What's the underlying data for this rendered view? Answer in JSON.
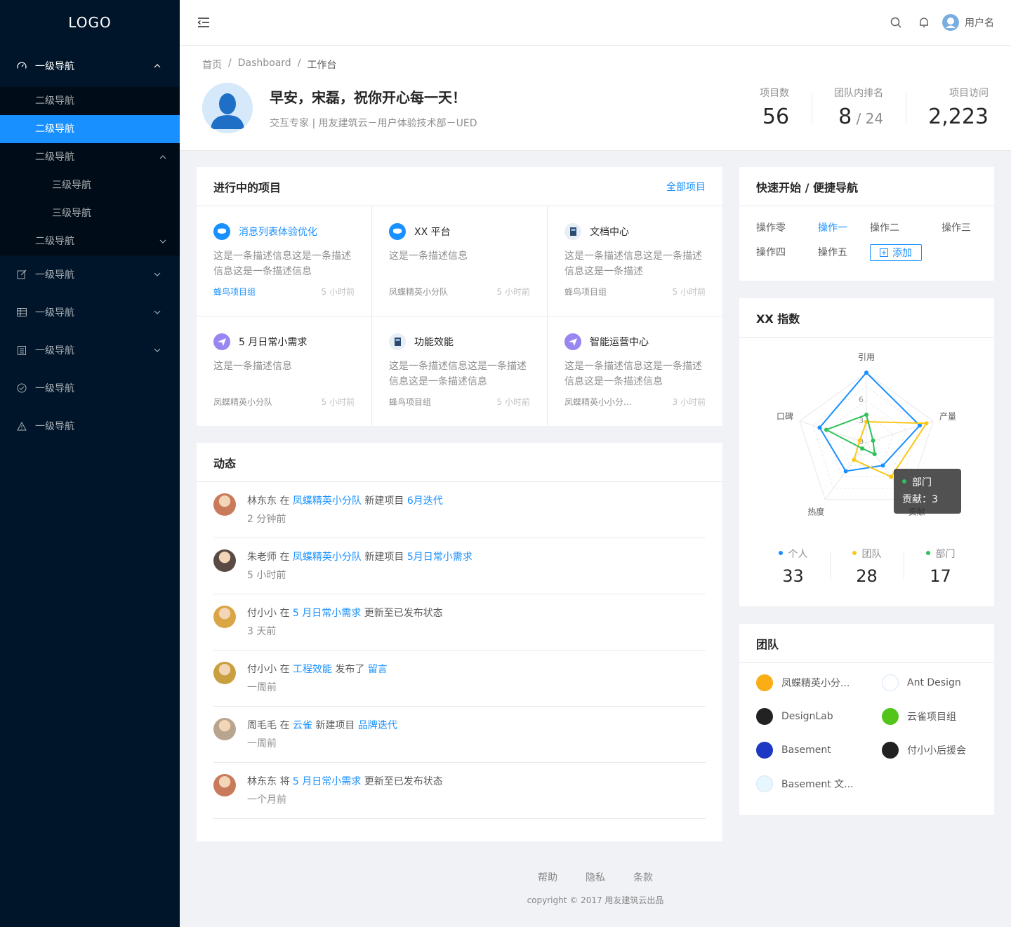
{
  "logo": "LOGO",
  "sidebar": {
    "group1": {
      "label": "一级导航",
      "items": [
        "二级导航",
        "二级导航"
      ],
      "expanded_item": "二级导航",
      "sub_items": [
        "三级导航",
        "三级导航"
      ],
      "last_item": "二级导航"
    },
    "others": [
      "一级导航",
      "一级导航",
      "一级导航",
      "一级导航",
      "一级导航"
    ]
  },
  "header": {
    "username": "用户名"
  },
  "breadcrumb": [
    "首页",
    "Dashboard",
    "工作台"
  ],
  "greeting": "早安，宋磊，祝你开心每一天！",
  "user_info": "交互专家 | 用友建筑云－用户体验技术部－UED",
  "stats": [
    {
      "title": "项目数",
      "value": "56"
    },
    {
      "title": "团队内排名",
      "value": "8",
      "total": "/ 24"
    },
    {
      "title": "项目访问",
      "value": "2,223"
    }
  ],
  "projects": {
    "title": "进行中的项目",
    "all_link": "全部项目",
    "items": [
      {
        "name": "消息列表体验优化",
        "desc": "这是一条描述信息这是一条描述信息这是一条描述信息",
        "group": "蜂鸟项目组",
        "time": "5 小时前",
        "icon": "message-bubble-icon"
      },
      {
        "name": "XX 平台",
        "desc": "这是一条描述信息",
        "group": "凤蝶精英小分队",
        "time": "5 小时前",
        "icon": "message-bubble-icon"
      },
      {
        "name": "文档中心",
        "desc": "这是一条描述信息这是一条描述信息这是一条描述",
        "group": "蜂鸟项目组",
        "time": "5 小时前",
        "icon": "book-icon"
      },
      {
        "name": "5 月日常小需求",
        "desc": "这是一条描述信息",
        "group": "凤蝶精英小分队",
        "time": "5 小时前",
        "icon": "paper-plane-icon"
      },
      {
        "name": "功能效能",
        "desc": "这是一条描述信息这是一条描述信息这是一条描述信息",
        "group": "蜂鸟项目组",
        "time": "5 小时前",
        "icon": "book-icon"
      },
      {
        "name": "智能运营中心",
        "desc": "这是一条描述信息这是一条描述信息这是一条描述信息",
        "group": "凤蝶精英小小分...",
        "time": "3 小时前",
        "icon": "paper-plane-icon"
      }
    ]
  },
  "activity": {
    "title": "动态",
    "items": [
      {
        "user": "林东东",
        "verb": "在",
        "target": "凤蝶精英小分队",
        "action": "新建项目",
        "obj": "6月迭代",
        "tail": "",
        "time": "2 分钟前"
      },
      {
        "user": "朱老师",
        "verb": "在",
        "target": "凤蝶精英小分队",
        "action": "新建项目",
        "obj": "5月日常小需求",
        "tail": "",
        "time": "5 小时前"
      },
      {
        "user": "付小小",
        "verb": "在",
        "target": "5 月日常小需求",
        "action": "更新至已发布状态",
        "obj": "",
        "tail": "",
        "time": "3 天前"
      },
      {
        "user": "付小小",
        "verb": "在",
        "target": "工程效能",
        "action": "发布了",
        "obj": "留言",
        "tail": "",
        "time": "一周前"
      },
      {
        "user": "周毛毛",
        "verb": "在",
        "target": "云雀",
        "action": "新建项目",
        "obj": "品牌迭代",
        "tail": "",
        "time": "一周前"
      },
      {
        "user": "林东东",
        "verb": "将",
        "target": "5 月日常小需求",
        "action": "更新至已发布状态",
        "obj": "",
        "tail": "",
        "time": "一个月前"
      }
    ]
  },
  "quick": {
    "title": "快速开始 / 便捷导航",
    "links": [
      "操作零",
      "操作一",
      "操作二",
      "操作三",
      "操作四",
      "操作五"
    ],
    "add_label": "添加"
  },
  "radar": {
    "title": "XX 指数",
    "tooltip": {
      "name": "部门",
      "label": "贡献：",
      "value": "3"
    },
    "legend": [
      {
        "name": "个人",
        "value": "33",
        "color": "#1890ff"
      },
      {
        "name": "团队",
        "value": "28",
        "color": "#fac714"
      },
      {
        "name": "部门",
        "value": "17",
        "color": "#2fc25b"
      }
    ]
  },
  "chart_data": {
    "type": "radar",
    "axes": [
      "引用",
      "产量",
      "贡献",
      "热度",
      "口碑"
    ],
    "ticks": [
      "0",
      "3",
      "6"
    ],
    "series": [
      {
        "name": "个人",
        "values": [
          10,
          8,
          4,
          5,
          7
        ]
      },
      {
        "name": "团队",
        "values": [
          3,
          9,
          6,
          3,
          1
        ]
      },
      {
        "name": "部门",
        "values": [
          4,
          1,
          2,
          1,
          6
        ]
      }
    ]
  },
  "team": {
    "title": "团队",
    "items": [
      {
        "name": "凤蝶精英小分...",
        "color": "#faad14"
      },
      {
        "name": "Ant Design",
        "color": "#ffffff"
      },
      {
        "name": "DesignLab",
        "color": "#222222"
      },
      {
        "name": "云雀项目组",
        "color": "#52c41a"
      },
      {
        "name": "Basement",
        "color": "#1d39c4"
      },
      {
        "name": "付小小后援会",
        "color": "#222222"
      },
      {
        "name": "Basement 文...",
        "color": "#e6f7ff"
      }
    ]
  },
  "footer": {
    "links": [
      "帮助",
      "隐私",
      "条款"
    ],
    "copyright": "copyright © 2017 用友建筑云出品"
  }
}
